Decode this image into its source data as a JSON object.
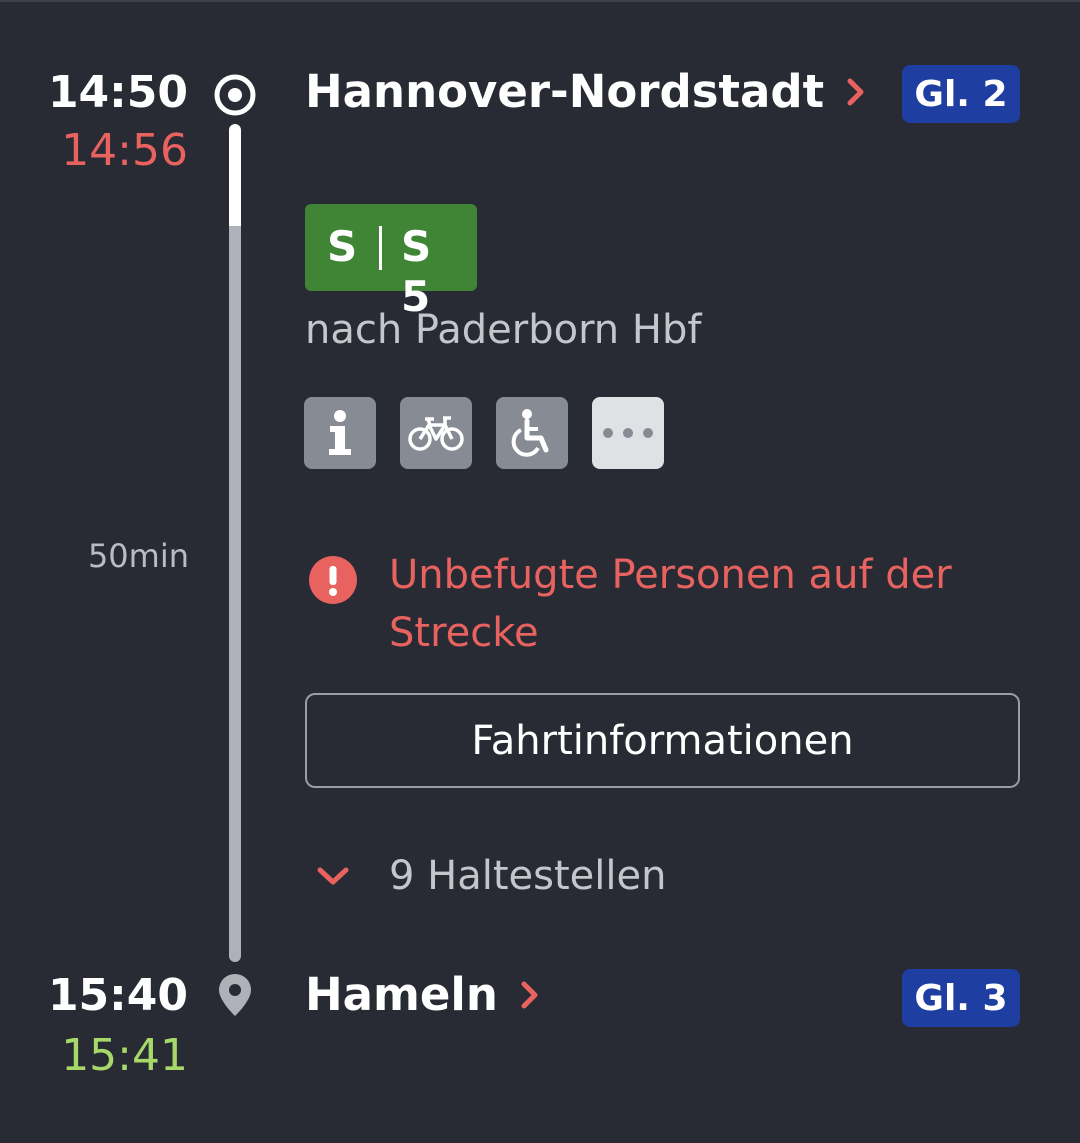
{
  "origin": {
    "time_planned": "14:50",
    "time_actual": "14:56",
    "station": "Hannover-Nordstadt",
    "platform": "Gl. 2"
  },
  "train": {
    "product": "S",
    "line": "S 5",
    "direction": "nach Paderborn Hbf",
    "attributes": [
      "info-icon",
      "bicycle-icon",
      "wheelchair-icon",
      "more-icon"
    ]
  },
  "duration": "50min",
  "message": "Unbefugte Personen auf der Strecke",
  "trip_info_button": "Fahrtinformationen",
  "stops_toggle": "9 Haltestellen",
  "destination": {
    "time_planned": "15:40",
    "time_actual": "15:41",
    "station": "Hameln",
    "platform": "Gl. 3"
  },
  "colors": {
    "background": "#282b34",
    "delay": "#e8625f",
    "on_time": "#a7d86a",
    "platform_badge": "#1e3ea1",
    "s_bahn_badge": "#408435"
  }
}
